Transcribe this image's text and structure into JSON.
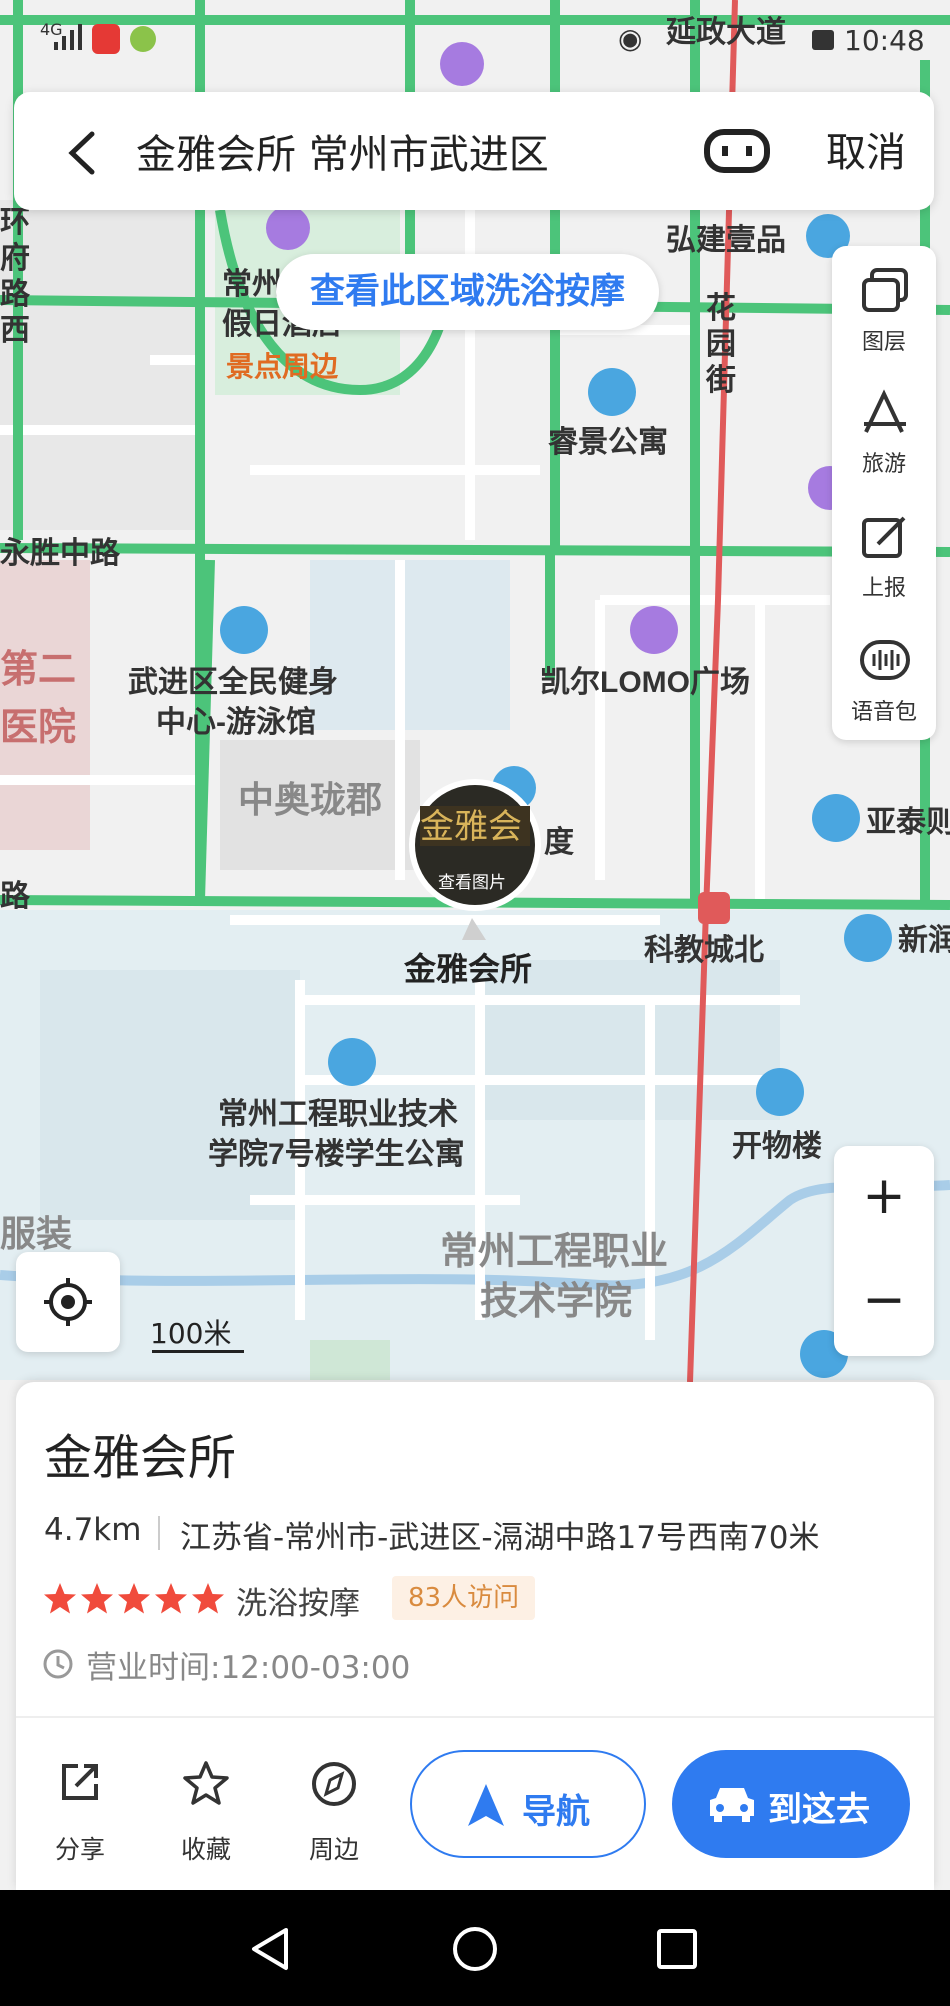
{
  "status_bar": {
    "network": "4G",
    "street_overlay": "延政大道",
    "time": "10:48"
  },
  "search": {
    "query": "金雅会所 常州市武进区",
    "cancel_label": "取消"
  },
  "area_search_label": "查看此区域洗浴按摩",
  "toolbox": {
    "items": [
      {
        "label": "图层",
        "icon": "layers-icon"
      },
      {
        "label": "旅游",
        "icon": "travel-icon"
      },
      {
        "label": "上报",
        "icon": "report-icon"
      },
      {
        "label": "语音包",
        "icon": "voice-icon"
      }
    ]
  },
  "map": {
    "road_labels": [
      "永胜中路",
      "延政大道",
      "花园街",
      "环府路西"
    ],
    "poi_labels": [
      "弘建壹品",
      "睿景公寓",
      "常州假日酒店",
      "景点周边",
      "武进区全民健身中心-游泳馆",
      "凯尔LOMO广场",
      "中奥珑郡",
      "度",
      "亚泰则",
      "新润",
      "科教城北",
      "常州工程职业技术学院7号楼学生公寓",
      "开物楼",
      "常州工程职业技术学院",
      "第二医院",
      "服装",
      "路"
    ],
    "marker": {
      "photo_text": "金雅会",
      "view_photo": "查看图片",
      "name": "金雅会所"
    },
    "scale_label": "100米",
    "zoom_in": "+",
    "zoom_out": "−",
    "colors": {
      "road_green": "#4cc47a",
      "metro_red": "#e05a5a",
      "accent": "#2f7bf0"
    }
  },
  "place_card": {
    "name": "金雅会所",
    "distance": "4.7km",
    "address": "江苏省-常州市-武进区-滆湖中路17号西南70米",
    "rating_stars": 5,
    "category": "洗浴按摩",
    "visits": "83人访问",
    "hours": "营业时间:12:00-03:00",
    "actions": [
      {
        "label": "分享",
        "icon": "share-icon"
      },
      {
        "label": "收藏",
        "icon": "star-icon"
      },
      {
        "label": "周边",
        "icon": "compass-icon"
      }
    ],
    "navigate_label": "导航",
    "go_label": "到这去"
  }
}
